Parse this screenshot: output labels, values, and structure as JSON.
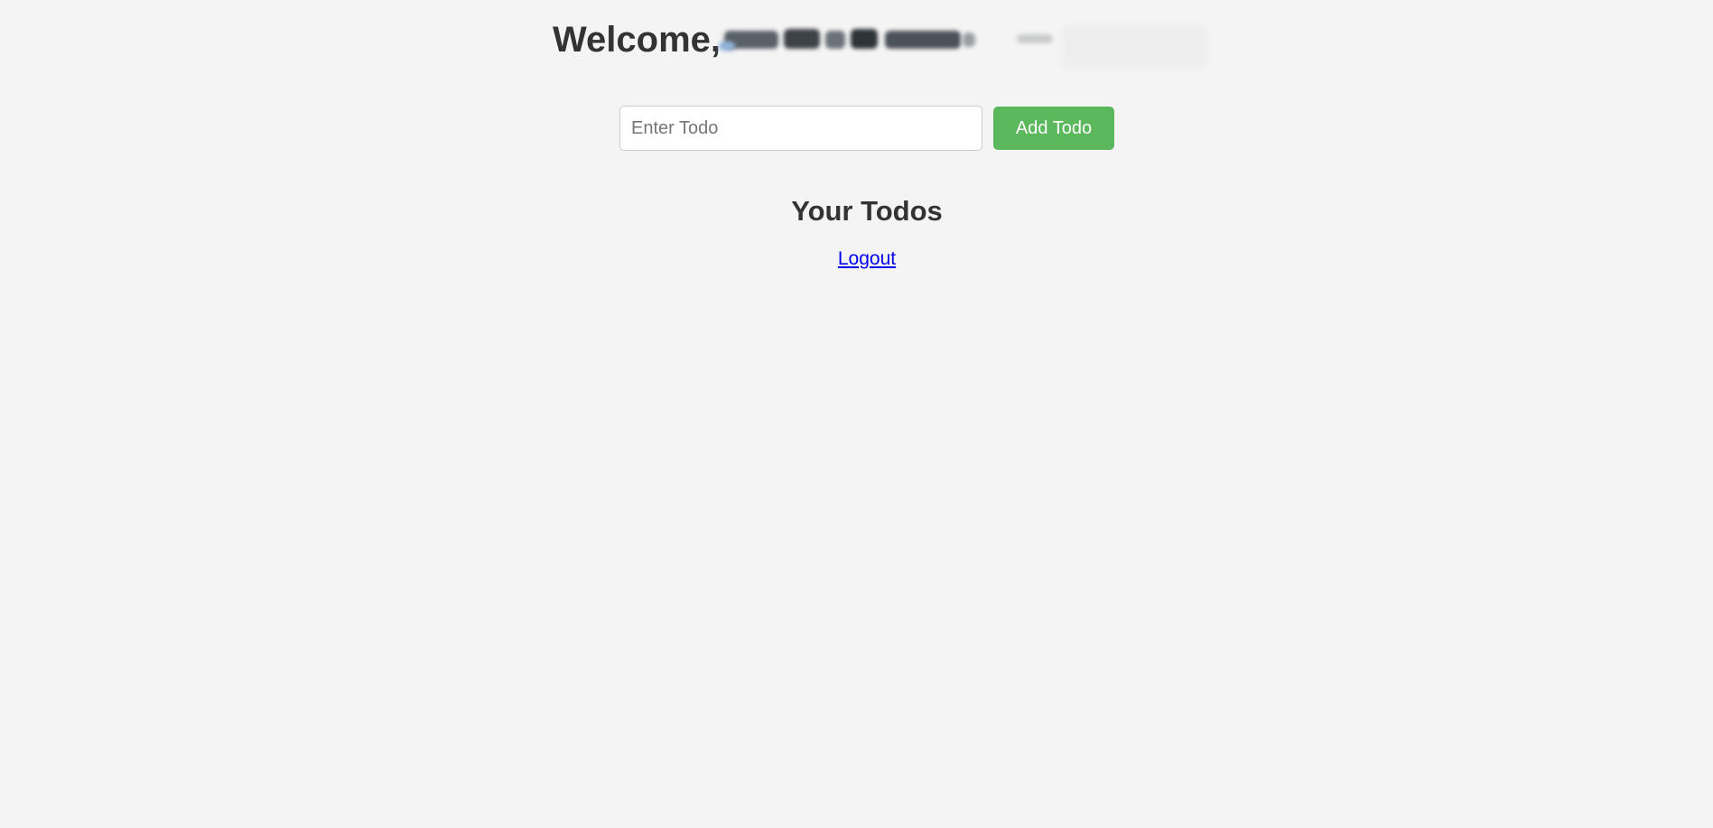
{
  "header": {
    "welcome_text": "Welcome,"
  },
  "todo_form": {
    "input_placeholder": "Enter Todo",
    "input_value": "",
    "add_button_label": "Add Todo"
  },
  "todos_section": {
    "heading": "Your Todos",
    "items": []
  },
  "nav": {
    "logout_label": "Logout"
  },
  "colors": {
    "background": "#f4f4f4",
    "text": "#333333",
    "add_button": "#5cb85c",
    "link": "#0000ee"
  }
}
